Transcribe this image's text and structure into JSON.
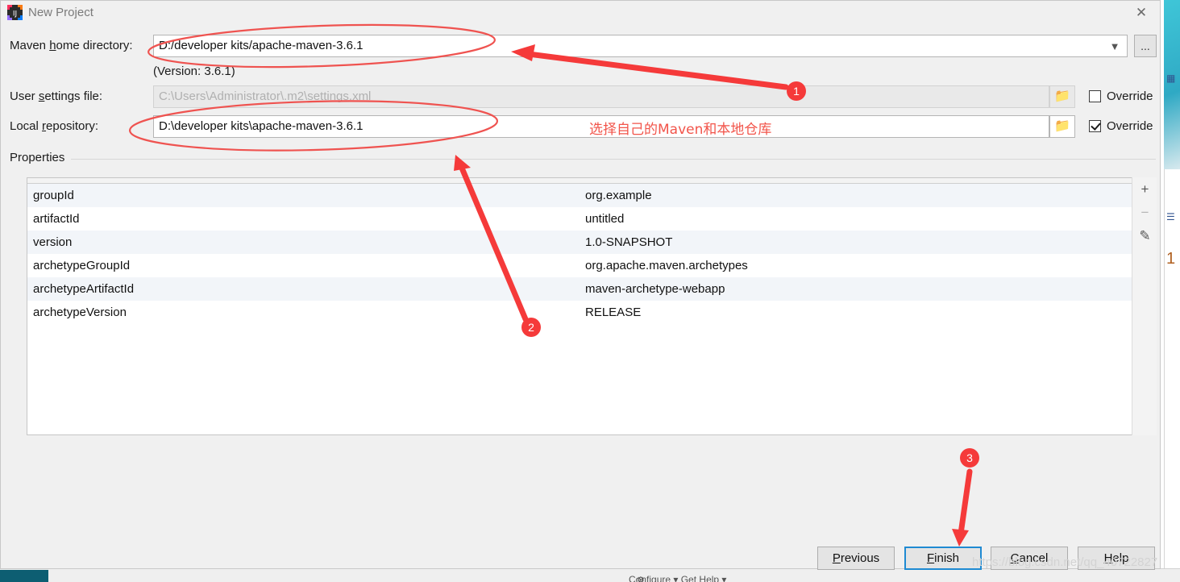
{
  "window": {
    "title": "New Project",
    "app_icon": "intellij-idea-icon",
    "close_icon": "close-icon"
  },
  "form": {
    "maven_home": {
      "label_before": "Maven ",
      "label_mnemonic": "h",
      "label_after": "ome directory:",
      "value": "D:/developer  kits/apache-maven-3.6.1",
      "version_note": "(Version: 3.6.1)",
      "dropdown_icon": "chevron-down-icon",
      "browse_label": "..."
    },
    "user_settings": {
      "label_before": "User ",
      "label_mnemonic": "s",
      "label_after": "ettings file:",
      "value": "C:\\Users\\Administrator\\.m2\\settings.xml",
      "folder_icon": "folder-icon",
      "override_label": "Override",
      "override_checked": false
    },
    "local_repository": {
      "label_before": "Local ",
      "label_mnemonic": "r",
      "label_after": "epository:",
      "value": "D:\\developer  kits\\apache-maven-3.6.1",
      "folder_icon": "folder-icon",
      "override_label": "Override",
      "override_checked": true
    }
  },
  "properties": {
    "section_label": "Properties",
    "rows": [
      {
        "key": "groupId",
        "value": "org.example"
      },
      {
        "key": "artifactId",
        "value": "untitled"
      },
      {
        "key": "version",
        "value": "1.0-SNAPSHOT"
      },
      {
        "key": "archetypeGroupId",
        "value": "org.apache.maven.archetypes"
      },
      {
        "key": "archetypeArtifactId",
        "value": "maven-archetype-webapp"
      },
      {
        "key": "archetypeVersion",
        "value": "RELEASE"
      }
    ],
    "tools": {
      "add": "+",
      "remove": "−",
      "edit": "✎"
    }
  },
  "buttons": {
    "previous": {
      "before": "",
      "mnemonic": "P",
      "after": "revious"
    },
    "finish": {
      "before": "",
      "mnemonic": "F",
      "after": "inish"
    },
    "cancel": {
      "before": "",
      "mnemonic": "C",
      "after": "ancel"
    },
    "help": {
      "before": "",
      "mnemonic": "H",
      "after": "elp"
    }
  },
  "annotations": {
    "note_cn": "选择自己的Maven和本地仓库",
    "markers": [
      {
        "id": "1",
        "label": "1"
      },
      {
        "id": "2",
        "label": "2"
      },
      {
        "id": "3",
        "label": "3"
      }
    ],
    "accent_color": "#f53a3a"
  },
  "watermark": {
    "text": "https://blog.csdn.net/qq_40722827"
  },
  "background": {
    "bottom_text": "Configure ▾   Get Help ▾"
  }
}
